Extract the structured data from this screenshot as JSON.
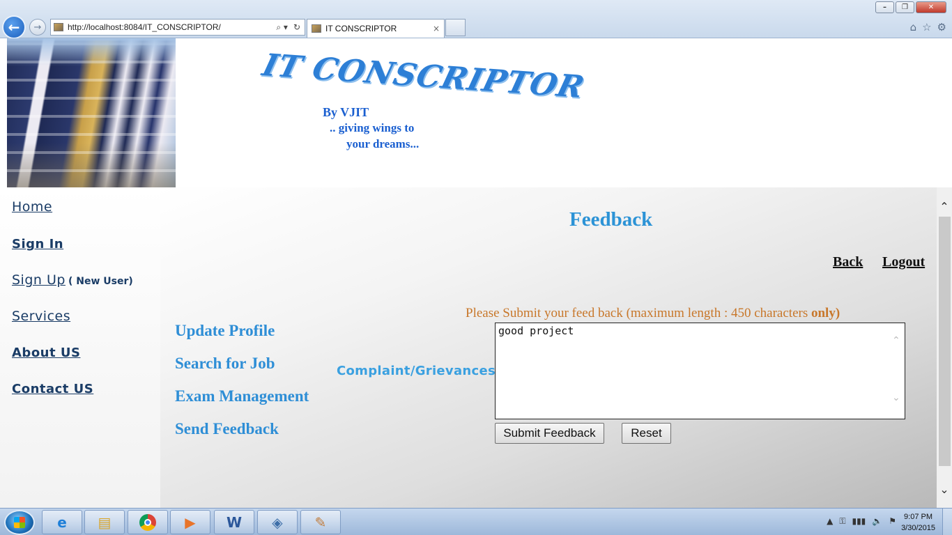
{
  "browser": {
    "url": "http://localhost:8084/IT_CONSCRIPTOR/",
    "tab_title": "IT CONSCRIPTOR",
    "tab_close": "×",
    "window_buttons": [
      "–",
      "❐",
      "✕"
    ],
    "back_glyph": "←",
    "forward_glyph": "→",
    "address_icons": [
      "⌕ ▾",
      "↻"
    ],
    "tools": [
      "⌂",
      "☆",
      "⚙"
    ]
  },
  "header": {
    "logo": "IT CONSCRIPTOR",
    "tagline": [
      "By VJIT",
      ".. giving wings to",
      "your dreams..."
    ]
  },
  "nav": {
    "home": "Home",
    "sign_in": "Sign In",
    "sign_up": "Sign Up",
    "sign_up_note": "( New User)",
    "services": "Services",
    "about": "About US",
    "contact": "Contact US"
  },
  "main": {
    "title": "Feedback",
    "back": "Back",
    "logout": "Logout",
    "side_actions": [
      "Update Profile",
      "Search for Job",
      "Exam Management",
      "Send Feedback"
    ],
    "instruction": "Please Submit your feed back (maximum length : 450 characters",
    "instruction_emph": "only)",
    "complaint_label": "Complaint/Grievances :",
    "textarea_value": "good project",
    "submit_label": "Submit Feedback",
    "reset_label": "Reset"
  },
  "scrollbar": {
    "up": "⌃",
    "down": "⌄"
  },
  "taskbar": {
    "apps": [
      "internet-explorer",
      "file-explorer",
      "chrome",
      "media-player",
      "word",
      "virtualbox",
      "paint"
    ],
    "tray_icons": [
      "▲",
      "⚿",
      "▮▮▮",
      "🔈",
      "⚑"
    ],
    "time": "9:07 PM",
    "date": "3/30/2015"
  },
  "colors": {
    "accent_blue": "#2c93d6",
    "nav_text": "#1a3c66",
    "instruction_orange": "#c8772a",
    "tagline_blue": "#1a5fd0"
  }
}
